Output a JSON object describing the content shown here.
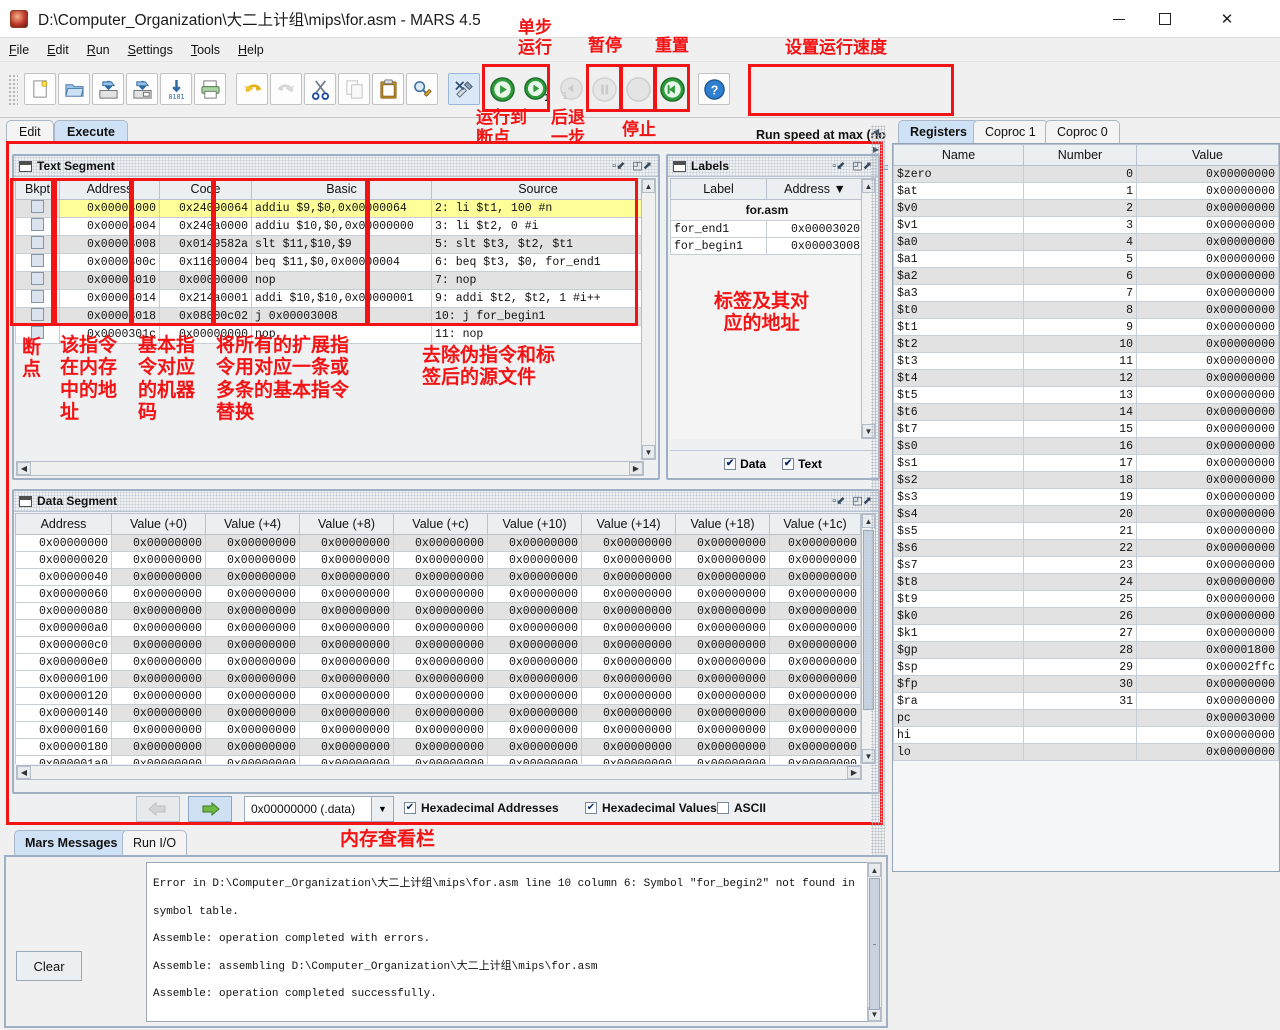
{
  "window": {
    "title": "D:\\Computer_Organization\\大二上计组\\mips\\for.asm  - MARS 4.5",
    "minimize": "–",
    "maximize": "□",
    "close": "✕"
  },
  "menu": [
    "File",
    "Edit",
    "Run",
    "Settings",
    "Tools",
    "Help"
  ],
  "toolbar": {
    "icons": [
      "new-file-icon",
      "open-file-icon",
      "save-file-icon",
      "save-as-icon",
      "dump-memory-icon",
      "print-icon",
      "undo-icon",
      "redo-icon",
      "cut-icon",
      "copy-icon",
      "paste-icon",
      "find-replace-icon",
      "assemble-icon",
      "run-icon",
      "step-icon",
      "backstep-icon",
      "pause-icon",
      "stop-icon",
      "reset-icon",
      "help-icon"
    ],
    "run_speed_label": "Run speed at max (no interaction)"
  },
  "annotations": {
    "single_step": "单步\n运行",
    "pause": "暂停",
    "reset": "重置",
    "set_speed": "设置运行速度",
    "run_to_breakpoint": "运行到\n断点",
    "backstep": "后退\n一步",
    "stop": "停止",
    "bkpt": "断\n点",
    "address": "该指令\n在内存\n中的地\n址",
    "code": "基本指\n令对应\n的机器\n码",
    "basic": "将所有的扩展指\n令用对应一条或\n多条的基本指令\n替换",
    "source": "去除伪指令和标\n签后的源文件",
    "labels": "标签及其对\n应的地址",
    "memory_view": "内存查看栏"
  },
  "exec_tabs": [
    {
      "label": "Edit",
      "active": false
    },
    {
      "label": "Execute",
      "active": true
    }
  ],
  "text_segment": {
    "title": "Text Segment",
    "columns": [
      "Bkpt",
      "Address",
      "Code",
      "Basic",
      "Source"
    ],
    "rows": [
      {
        "bkpt": "",
        "address": "0x00003000",
        "code": "0x24090064",
        "basic": "addiu $9,$0,0x00000064",
        "source": "2: li $t1, 100 #n",
        "highlight": true,
        "alt": true
      },
      {
        "bkpt": "",
        "address": "0x00003004",
        "code": "0x240a0000",
        "basic": "addiu $10,$0,0x00000000",
        "source": "3: li $t2, 0   #i",
        "highlight": false,
        "alt": false
      },
      {
        "bkpt": "",
        "address": "0x00003008",
        "code": "0x0149582a",
        "basic": "slt $11,$10,$9",
        "source": "5:    slt $t3, $t2, $t1",
        "highlight": false,
        "alt": true
      },
      {
        "bkpt": "",
        "address": "0x0000300c",
        "code": "0x11600004",
        "basic": "beq $11,$0,0x00000004",
        "source": "6:    beq $t3, $0, for_end1",
        "highlight": false,
        "alt": false
      },
      {
        "bkpt": "",
        "address": "0x00003010",
        "code": "0x00000000",
        "basic": "nop",
        "source": "7:    nop",
        "highlight": false,
        "alt": true
      },
      {
        "bkpt": "",
        "address": "0x00003014",
        "code": "0x214a0001",
        "basic": "addi $10,$10,0x00000001",
        "source": "9:    addi $t2, $t2, 1 #i++",
        "highlight": false,
        "alt": false
      },
      {
        "bkpt": "",
        "address": "0x00003018",
        "code": "0x08000c02",
        "basic": "j 0x00003008",
        "source": "10:   j for_begin1",
        "highlight": false,
        "alt": true
      },
      {
        "bkpt": "",
        "address": "0x0000301c",
        "code": "0x00000000",
        "basic": "nop",
        "source": "11:   nop",
        "highlight": false,
        "alt": false
      }
    ]
  },
  "labels_panel": {
    "title": "Labels",
    "columns": [
      "Label",
      "Address ▼"
    ],
    "file_group": "for.asm",
    "rows": [
      {
        "label": "for_end1",
        "address": "0x00003020"
      },
      {
        "label": "for_begin1",
        "address": "0x00003008"
      }
    ],
    "checkboxes": [
      {
        "label": "Data",
        "checked": true
      },
      {
        "label": "Text",
        "checked": true
      }
    ]
  },
  "data_segment": {
    "title": "Data Segment",
    "columns": [
      "Address",
      "Value (+0)",
      "Value (+4)",
      "Value (+8)",
      "Value (+c)",
      "Value (+10)",
      "Value (+14)",
      "Value (+18)",
      "Value (+1c)"
    ],
    "addresses": [
      "0x00000000",
      "0x00000020",
      "0x00000040",
      "0x00000060",
      "0x00000080",
      "0x000000a0",
      "0x000000c0",
      "0x000000e0",
      "0x00000100",
      "0x00000120",
      "0x00000140",
      "0x00000160",
      "0x00000180",
      "0x000001a0"
    ],
    "cell_value": "0x00000000",
    "controls": {
      "prev_icon": "left-arrow-icon",
      "next_icon": "right-arrow-icon",
      "selected_range": "0x00000000 (.data)",
      "dropdown_icon": "chevron-down-icon",
      "checkboxes": [
        {
          "label": "Hexadecimal Addresses",
          "checked": true
        },
        {
          "label": "Hexadecimal Values",
          "checked": true
        },
        {
          "label": "ASCII",
          "checked": false
        }
      ]
    }
  },
  "registers": {
    "tabs": [
      {
        "label": "Registers",
        "active": true
      },
      {
        "label": "Coproc 1",
        "active": false
      },
      {
        "label": "Coproc 0",
        "active": false
      }
    ],
    "columns": [
      "Name",
      "Number",
      "Value"
    ],
    "rows": [
      {
        "name": "$zero",
        "number": "0",
        "value": "0x00000000"
      },
      {
        "name": "$at",
        "number": "1",
        "value": "0x00000000"
      },
      {
        "name": "$v0",
        "number": "2",
        "value": "0x00000000"
      },
      {
        "name": "$v1",
        "number": "3",
        "value": "0x00000000"
      },
      {
        "name": "$a0",
        "number": "4",
        "value": "0x00000000"
      },
      {
        "name": "$a1",
        "number": "5",
        "value": "0x00000000"
      },
      {
        "name": "$a2",
        "number": "6",
        "value": "0x00000000"
      },
      {
        "name": "$a3",
        "number": "7",
        "value": "0x00000000"
      },
      {
        "name": "$t0",
        "number": "8",
        "value": "0x00000000"
      },
      {
        "name": "$t1",
        "number": "9",
        "value": "0x00000000"
      },
      {
        "name": "$t2",
        "number": "10",
        "value": "0x00000000"
      },
      {
        "name": "$t3",
        "number": "11",
        "value": "0x00000000"
      },
      {
        "name": "$t4",
        "number": "12",
        "value": "0x00000000"
      },
      {
        "name": "$t5",
        "number": "13",
        "value": "0x00000000"
      },
      {
        "name": "$t6",
        "number": "14",
        "value": "0x00000000"
      },
      {
        "name": "$t7",
        "number": "15",
        "value": "0x00000000"
      },
      {
        "name": "$s0",
        "number": "16",
        "value": "0x00000000"
      },
      {
        "name": "$s1",
        "number": "17",
        "value": "0x00000000"
      },
      {
        "name": "$s2",
        "number": "18",
        "value": "0x00000000"
      },
      {
        "name": "$s3",
        "number": "19",
        "value": "0x00000000"
      },
      {
        "name": "$s4",
        "number": "20",
        "value": "0x00000000"
      },
      {
        "name": "$s5",
        "number": "21",
        "value": "0x00000000"
      },
      {
        "name": "$s6",
        "number": "22",
        "value": "0x00000000"
      },
      {
        "name": "$s7",
        "number": "23",
        "value": "0x00000000"
      },
      {
        "name": "$t8",
        "number": "24",
        "value": "0x00000000"
      },
      {
        "name": "$t9",
        "number": "25",
        "value": "0x00000000"
      },
      {
        "name": "$k0",
        "number": "26",
        "value": "0x00000000"
      },
      {
        "name": "$k1",
        "number": "27",
        "value": "0x00000000"
      },
      {
        "name": "$gp",
        "number": "28",
        "value": "0x00001800"
      },
      {
        "name": "$sp",
        "number": "29",
        "value": "0x00002ffc"
      },
      {
        "name": "$fp",
        "number": "30",
        "value": "0x00000000"
      },
      {
        "name": "$ra",
        "number": "31",
        "value": "0x00000000"
      },
      {
        "name": "pc",
        "number": "",
        "value": "0x00003000"
      },
      {
        "name": "hi",
        "number": "",
        "value": "0x00000000"
      },
      {
        "name": "lo",
        "number": "",
        "value": "0x00000000"
      }
    ]
  },
  "messages": {
    "tabs": [
      {
        "label": "Mars Messages",
        "active": true
      },
      {
        "label": "Run I/O",
        "active": false
      }
    ],
    "clear_label": "Clear",
    "lines": [
      "Error in D:\\Computer_Organization\\大二上计组\\mips\\for.asm line 10 column 6: Symbol \"for_begin2\" not found in symbol table.",
      "Assemble: operation completed with errors.",
      "",
      "Assemble: assembling D:\\Computer_Organization\\大二上计组\\mips\\for.asm",
      "",
      "Assemble: operation completed successfully."
    ]
  },
  "colors": {
    "annotation_red": "#f21414",
    "highlight_yellow": "#ffff99",
    "tab_active": "#cfe1f5",
    "titlebar_accent": "#1a6fb5"
  }
}
